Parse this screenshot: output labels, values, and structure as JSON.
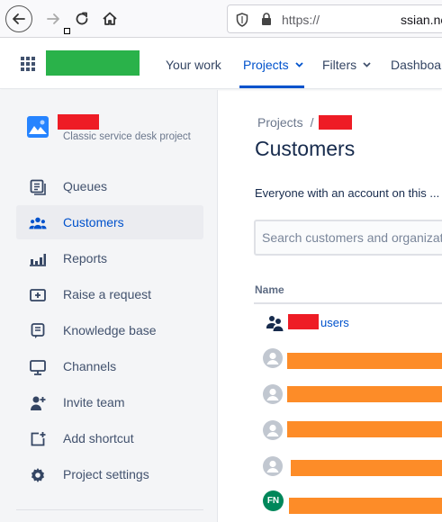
{
  "browser": {
    "url_scheme": "https://",
    "url_host": "ssian.ne"
  },
  "header": {
    "logo_color": "#2ab24a",
    "nav": [
      {
        "label": "Your work"
      },
      {
        "label": "Projects"
      },
      {
        "label": "Filters"
      },
      {
        "label": "Dashboar"
      }
    ]
  },
  "sidebar": {
    "project_type": "Classic service desk project",
    "items": [
      {
        "label": "Queues",
        "icon": "queues-icon"
      },
      {
        "label": "Customers",
        "icon": "customers-icon"
      },
      {
        "label": "Reports",
        "icon": "reports-icon"
      },
      {
        "label": "Raise a request",
        "icon": "raise-request-icon"
      },
      {
        "label": "Knowledge base",
        "icon": "knowledge-base-icon"
      },
      {
        "label": "Channels",
        "icon": "channels-icon"
      },
      {
        "label": "Invite team",
        "icon": "invite-team-icon"
      },
      {
        "label": "Add shortcut",
        "icon": "add-shortcut-icon"
      },
      {
        "label": "Project settings",
        "icon": "gear-icon"
      }
    ]
  },
  "main": {
    "breadcrumb_root": "Projects",
    "breadcrumb_sep": "/",
    "title": "Customers",
    "description": "Everyone with an account on this ...",
    "search_placeholder": "Search customers and organizations",
    "column_name": "Name",
    "group_row_label": "users",
    "last_avatar_initials": "FN"
  },
  "colors": {
    "accent": "#0052cc",
    "redaction_red": "#ee1c25",
    "redaction_orange": "#fd8c28",
    "avatar_green": "#00875a"
  }
}
